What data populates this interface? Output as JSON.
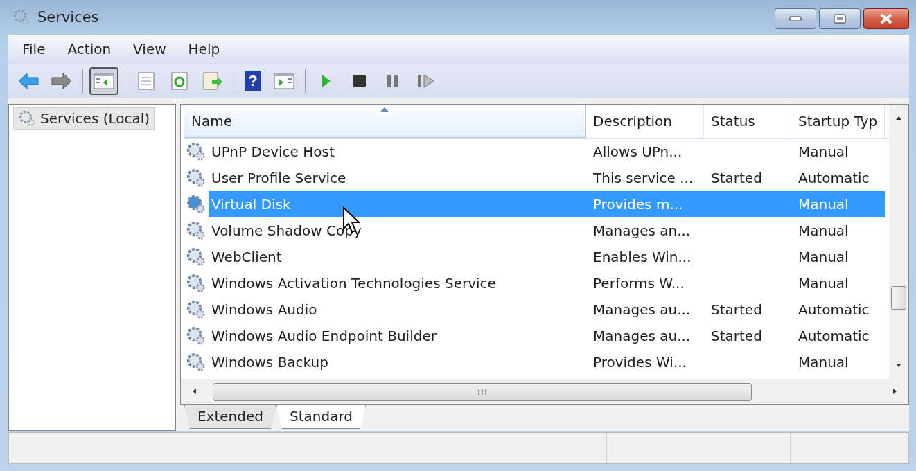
{
  "window": {
    "title": "Services"
  },
  "menu": [
    "File",
    "Action",
    "View",
    "Help"
  ],
  "toolbar": [
    {
      "kind": "back",
      "pressed": false
    },
    {
      "kind": "forward",
      "pressed": false
    },
    {
      "kind": "sep"
    },
    {
      "kind": "console-tree",
      "pressed": true
    },
    {
      "kind": "sep"
    },
    {
      "kind": "properties",
      "pressed": false
    },
    {
      "kind": "refresh",
      "pressed": false
    },
    {
      "kind": "export",
      "pressed": false
    },
    {
      "kind": "sep"
    },
    {
      "kind": "help",
      "pressed": false,
      "glyph": "?"
    },
    {
      "kind": "action-pane",
      "pressed": false
    },
    {
      "kind": "sep"
    },
    {
      "kind": "start",
      "pressed": false
    },
    {
      "kind": "stop",
      "pressed": false
    },
    {
      "kind": "pause",
      "pressed": false
    },
    {
      "kind": "resume",
      "pressed": false
    }
  ],
  "tree": {
    "items": [
      {
        "label": "Services (Local)",
        "selected": true
      }
    ]
  },
  "table": {
    "columns": [
      {
        "label": "Name",
        "sorted": true
      },
      {
        "label": "Description",
        "sorted": false
      },
      {
        "label": "Status",
        "sorted": false
      },
      {
        "label": "Startup Typ",
        "sorted": false
      }
    ],
    "rows": [
      {
        "name": "UPnP Device Host",
        "description": "Allows UPn...",
        "startup": "Manual",
        "selected": false
      },
      {
        "name": "User Profile Service",
        "description": "This service ...",
        "status": "Started",
        "startup": "Automatic",
        "selected": false
      },
      {
        "name": "Virtual Disk",
        "description": "Provides m...",
        "startup": "Manual",
        "selected": true
      },
      {
        "name": "Volume Shadow Copy",
        "description": "Manages an...",
        "startup": "Manual",
        "selected": false
      },
      {
        "name": "WebClient",
        "description": "Enables Win...",
        "startup": "Manual",
        "selected": false
      },
      {
        "name": "Windows Activation Technologies Service",
        "description": "Performs W...",
        "startup": "Manual",
        "selected": false
      },
      {
        "name": "Windows Audio",
        "description": "Manages au...",
        "status": "Started",
        "startup": "Automatic",
        "selected": false
      },
      {
        "name": "Windows Audio Endpoint Builder",
        "description": "Manages au...",
        "status": "Started",
        "startup": "Automatic",
        "selected": false
      },
      {
        "name": "Windows Backup",
        "description": "Provides Wi...",
        "startup": "Manual",
        "selected": false
      }
    ]
  },
  "view_tabs": [
    {
      "label": "Extended",
      "selected": false
    },
    {
      "label": "Standard",
      "selected": true
    }
  ]
}
